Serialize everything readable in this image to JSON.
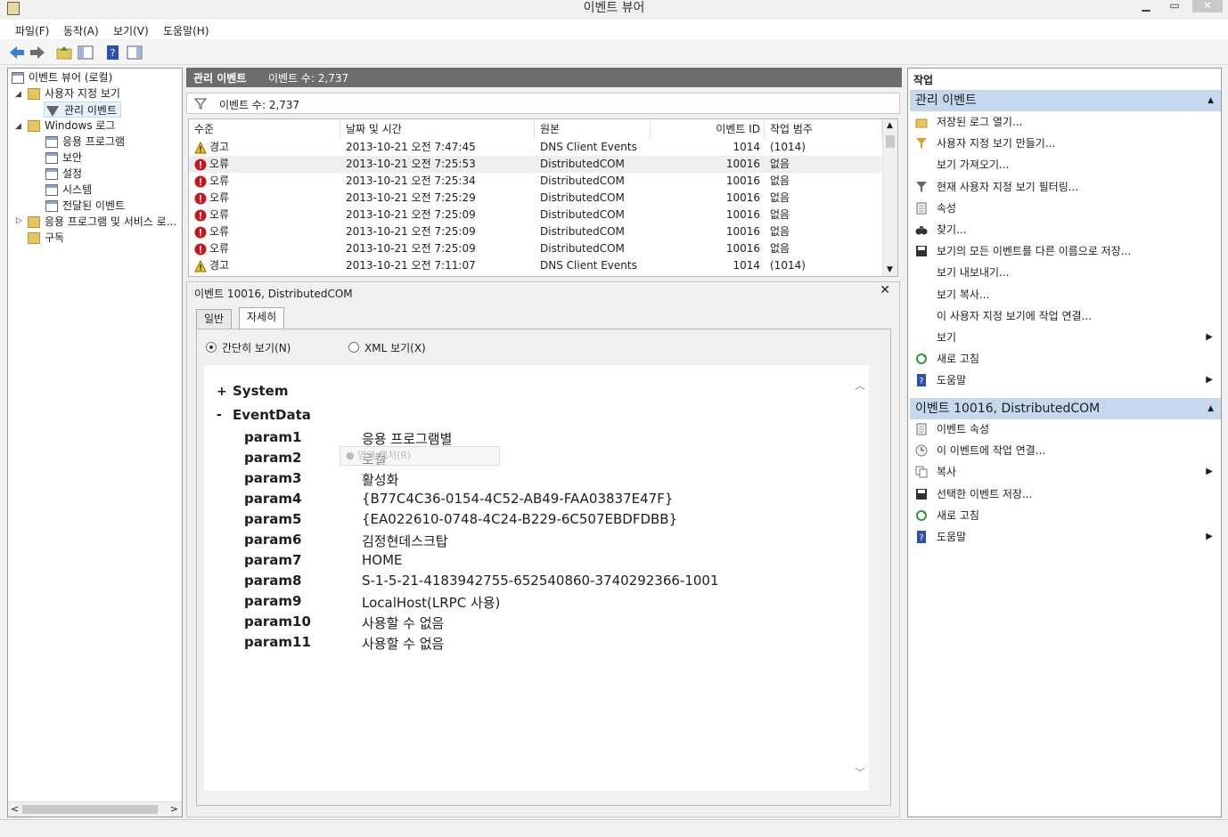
{
  "window": {
    "title": "이벤트 뷰어"
  },
  "menu": {
    "file": "파일(F)",
    "action": "동작(A)",
    "view": "보기(V)",
    "help": "도움말(H)"
  },
  "tree": {
    "root": "이벤트 뷰어 (로컬)",
    "custom_views": "사용자 지정 보기",
    "admin_events": "관리 이벤트",
    "windows_logs": "Windows 로그",
    "application": "응용 프로그램",
    "security": "보안",
    "setup": "설정",
    "system": "시스템",
    "forwarded": "전달된 이벤트",
    "apps_services": "응용 프로그램 및 서비스 로...",
    "subscriptions": "구독"
  },
  "center": {
    "title": "관리 이벤트",
    "count": "이벤트 수: 2,737",
    "filter_count": "이벤트 수: 2,737",
    "columns": {
      "level": "수준",
      "datetime": "날짜 및 시간",
      "source": "원본",
      "event_id": "이벤트 ID",
      "category": "작업 범주"
    },
    "rows": [
      {
        "level": "경고",
        "type": "warning",
        "datetime": "2013-10-21 오전 7:47:45",
        "source": "DNS Client Events",
        "event_id": "1014",
        "category": "(1014)"
      },
      {
        "level": "오류",
        "type": "error",
        "datetime": "2013-10-21 오전 7:25:53",
        "source": "DistributedCOM",
        "event_id": "10016",
        "category": "없음"
      },
      {
        "level": "오류",
        "type": "error",
        "datetime": "2013-10-21 오전 7:25:34",
        "source": "DistributedCOM",
        "event_id": "10016",
        "category": "없음"
      },
      {
        "level": "오류",
        "type": "error",
        "datetime": "2013-10-21 오전 7:25:29",
        "source": "DistributedCOM",
        "event_id": "10016",
        "category": "없음"
      },
      {
        "level": "오류",
        "type": "error",
        "datetime": "2013-10-21 오전 7:25:09",
        "source": "DistributedCOM",
        "event_id": "10016",
        "category": "없음"
      },
      {
        "level": "오류",
        "type": "error",
        "datetime": "2013-10-21 오전 7:25:09",
        "source": "DistributedCOM",
        "event_id": "10016",
        "category": "없음"
      },
      {
        "level": "오류",
        "type": "error",
        "datetime": "2013-10-21 오전 7:25:09",
        "source": "DistributedCOM",
        "event_id": "10016",
        "category": "없음"
      },
      {
        "level": "경고",
        "type": "warning",
        "datetime": "2013-10-21 오전 7:11:07",
        "source": "DNS Client Events",
        "event_id": "1014",
        "category": "(1014)"
      }
    ]
  },
  "detail": {
    "title": "이벤트 10016, DistributedCOM",
    "tab_general": "일반",
    "tab_details": "자세히",
    "radio_friendly": "간단히 보기(N)",
    "radio_xml": "XML 보기(X)",
    "system_label": "System",
    "system_toggle": "+",
    "eventdata_label": "EventData",
    "eventdata_toggle": "-",
    "tooltip": "● 영역 캡처(R)",
    "params": [
      {
        "name": "param1",
        "value": "응용 프로그램별"
      },
      {
        "name": "param2",
        "value": "로컬"
      },
      {
        "name": "param3",
        "value": "활성화"
      },
      {
        "name": "param4",
        "value": "{B77C4C36-0154-4C52-AB49-FAA03837E47F}"
      },
      {
        "name": "param5",
        "value": "{EA022610-0748-4C24-B229-6C507EBDFDBB}"
      },
      {
        "name": "param6",
        "value": "김정현데스크탑"
      },
      {
        "name": "param7",
        "value": "HOME"
      },
      {
        "name": "param8",
        "value": "S-1-5-21-4183942755-652540860-3740292366-1001"
      },
      {
        "name": "param9",
        "value": "LocalHost(LRPC 사용)"
      },
      {
        "name": "param10",
        "value": "사용할 수 없음"
      },
      {
        "name": "param11",
        "value": "사용할 수 없음"
      }
    ]
  },
  "actions": {
    "title": "작업",
    "section1": "관리 이벤트",
    "items1": [
      {
        "label": "저장된 로그 열기...",
        "icon": "open-folder-icon"
      },
      {
        "label": "사용자 지정 보기 만들기...",
        "icon": "filter-create-icon"
      },
      {
        "label": "보기 가져오기...",
        "icon": ""
      },
      {
        "label": "현재 사용자 지정 보기 필터링...",
        "icon": "filter-icon"
      },
      {
        "label": "속성",
        "icon": "properties-icon"
      },
      {
        "label": "찾기...",
        "icon": "binoculars-icon"
      },
      {
        "label": "보기의 모든 이벤트를 다른 이름으로 저장...",
        "icon": "save-icon"
      },
      {
        "label": "보기 내보내기...",
        "icon": ""
      },
      {
        "label": "보기 복사...",
        "icon": ""
      },
      {
        "label": "이 사용자 지정 보기에 작업 연결...",
        "icon": ""
      },
      {
        "label": "보기",
        "icon": ""
      },
      {
        "label": "새로 고침",
        "icon": "refresh-icon"
      },
      {
        "label": "도움말",
        "icon": "help-icon"
      }
    ],
    "section2": "이벤트 10016, DistributedCOM",
    "items2": [
      {
        "label": "이벤트 속성",
        "icon": "properties-icon"
      },
      {
        "label": "이 이벤트에 작업 연결...",
        "icon": "task-icon"
      },
      {
        "label": "복사",
        "icon": "copy-icon"
      },
      {
        "label": "선택한 이벤트 저장...",
        "icon": "save-icon"
      },
      {
        "label": "새로 고침",
        "icon": "refresh-icon"
      },
      {
        "label": "도움말",
        "icon": "help-icon"
      }
    ]
  }
}
